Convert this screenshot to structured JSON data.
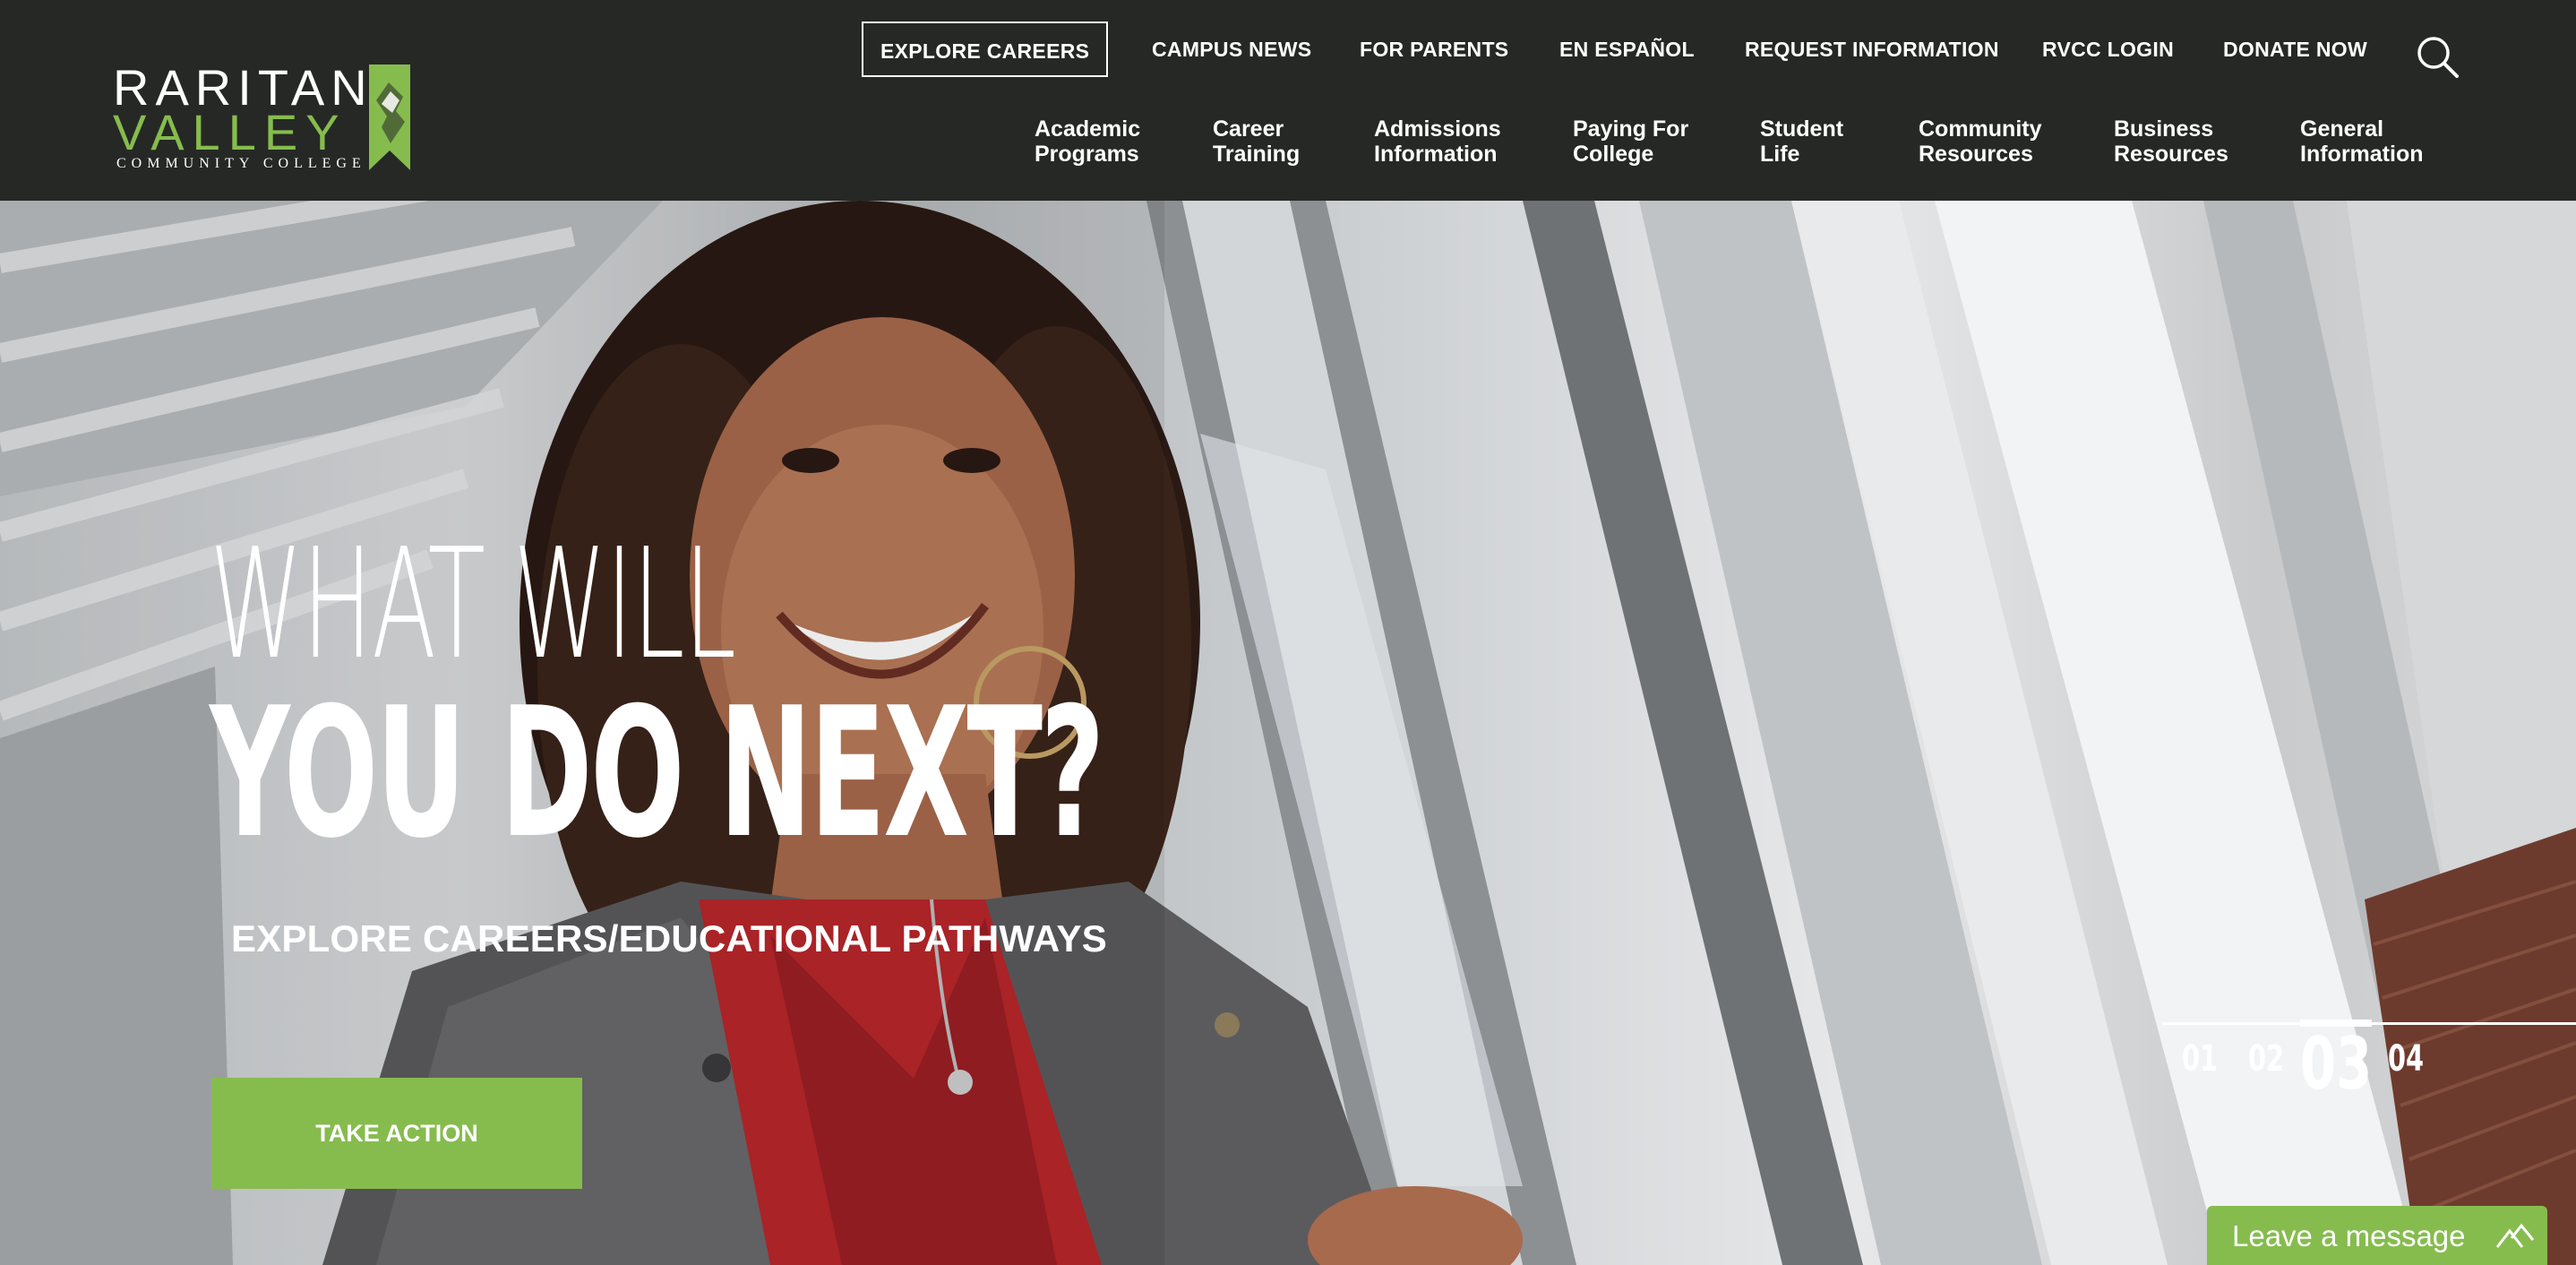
{
  "colors": {
    "header_bg": "#262826",
    "accent_green": "#86bc4e",
    "text": "#ffffff"
  },
  "logo": {
    "line1": "RARITAN",
    "line2": "VALLEY",
    "line3": "COMMUNITY COLLEGE"
  },
  "utility_nav": [
    {
      "label": "EXPLORE CAREERS"
    },
    {
      "label": "CAMPUS NEWS"
    },
    {
      "label": "FOR PARENTS"
    },
    {
      "label": "EN ESPAÑOL"
    },
    {
      "label": "REQUEST INFORMATION"
    },
    {
      "label": "RVCC LOGIN"
    },
    {
      "label": "DONATE NOW"
    }
  ],
  "search": {
    "icon": "search-icon"
  },
  "main_nav": [
    {
      "line1": "Academic",
      "line2": "Programs"
    },
    {
      "line1": "Career",
      "line2": "Training"
    },
    {
      "line1": "Admissions",
      "line2": "Information"
    },
    {
      "line1": "Paying For",
      "line2": "College"
    },
    {
      "line1": "Student",
      "line2": "Life"
    },
    {
      "line1": "Community",
      "line2": "Resources"
    },
    {
      "line1": "Business",
      "line2": "Resources"
    },
    {
      "line1": "General",
      "line2": "Information"
    }
  ],
  "hero": {
    "headline_line1": "WHAT WILL",
    "headline_line2": "YOU DO NEXT?",
    "subhead": "EXPLORE CAREERS/EDUCATIONAL PATHWAYS",
    "cta_label": "TAKE ACTION"
  },
  "slider": {
    "slides": [
      "01",
      "02",
      "03",
      "04"
    ],
    "active": "03"
  },
  "chat": {
    "label": "Leave a message",
    "icon": "chevron-up-icon"
  }
}
